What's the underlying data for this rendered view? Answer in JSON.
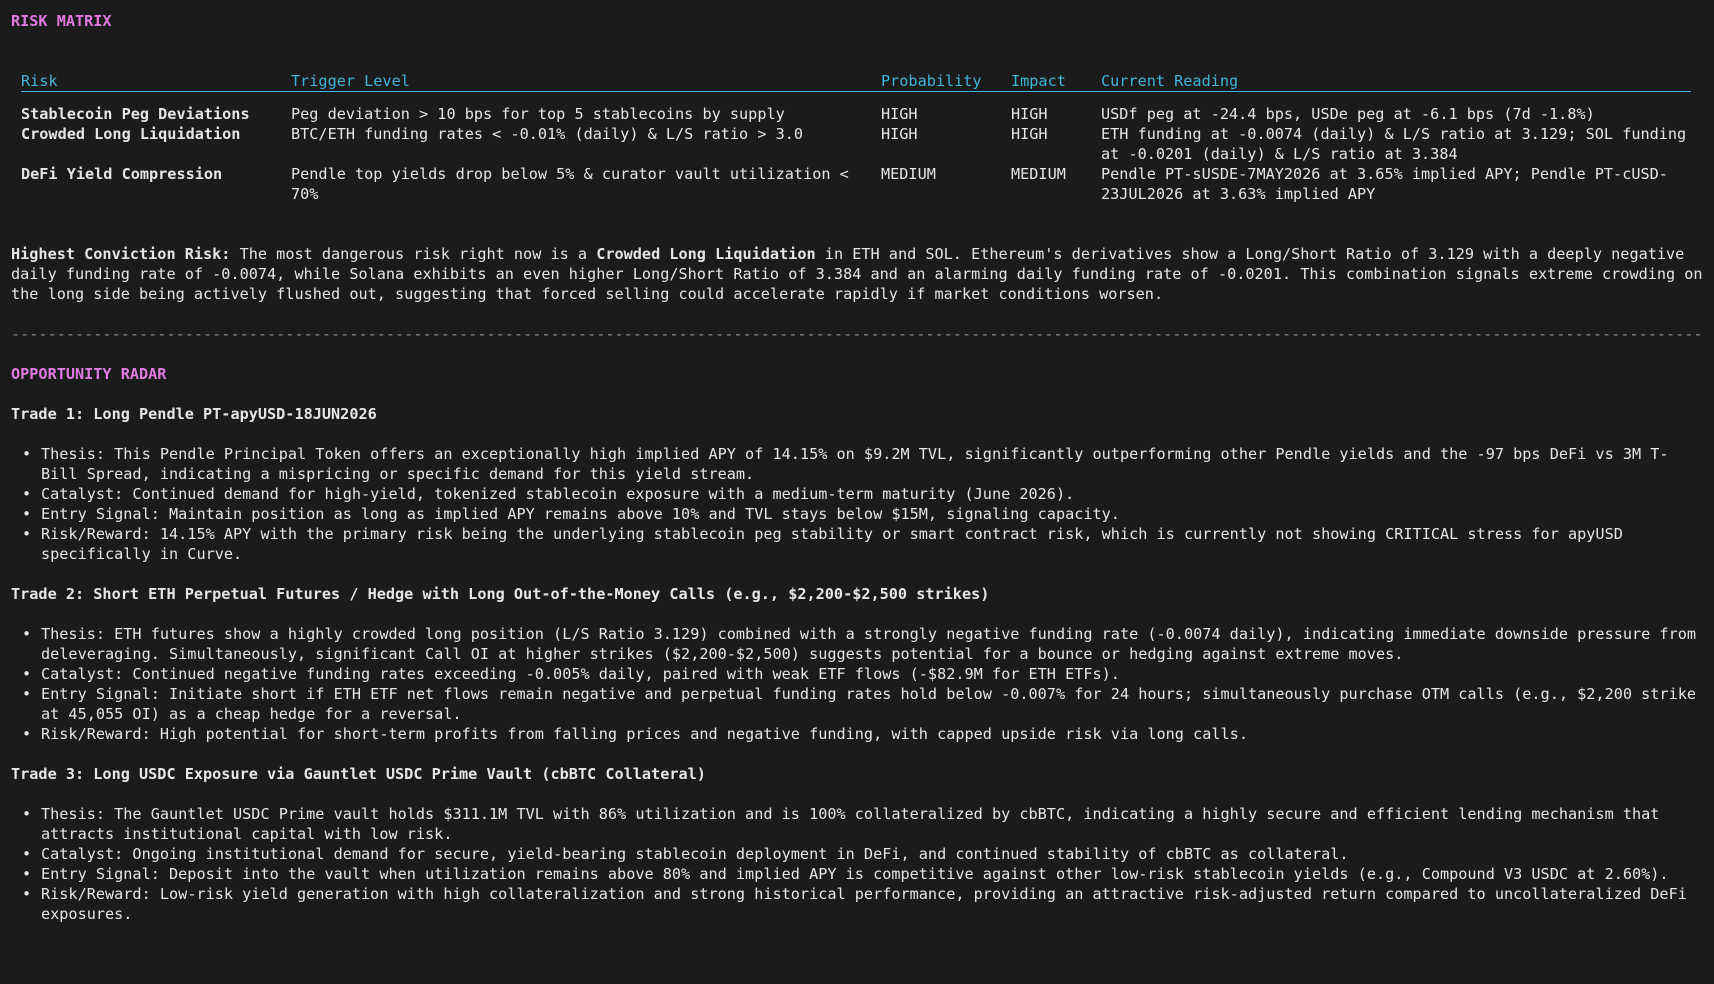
{
  "risk_matrix": {
    "title": "RISK MATRIX",
    "headers": {
      "risk": "Risk",
      "trigger": "Trigger Level",
      "probability": "Probability",
      "impact": "Impact",
      "current": "Current Reading"
    },
    "rows": [
      {
        "risk": "Stablecoin Peg Deviations",
        "trigger": "Peg deviation > 10 bps for top 5 stablecoins by supply",
        "probability": "HIGH",
        "impact": "HIGH",
        "current": "USDf peg at -24.4 bps, USDe peg at -6.1 bps (7d -1.8%)"
      },
      {
        "risk": "Crowded Long Liquidation",
        "trigger": "BTC/ETH funding rates < -0.01% (daily) & L/S ratio > 3.0",
        "probability": "HIGH",
        "impact": "HIGH",
        "current": "ETH funding at -0.0074 (daily) & L/S ratio at 3.129; SOL funding at -0.0201 (daily) & L/S ratio at 3.384"
      },
      {
        "risk": "DeFi Yield Compression",
        "trigger": "Pendle top yields drop below 5% & curator vault utilization < 70%",
        "probability": "MEDIUM",
        "impact": "MEDIUM",
        "current": "Pendle PT-sUSDE-7MAY2026 at 3.65% implied APY; Pendle PT-cUSD-23JUL2026 at 3.63% implied APY"
      }
    ]
  },
  "conviction": {
    "label": "Highest Conviction Risk:",
    "text_1": " The most dangerous risk right now is a ",
    "highlight": "Crowded Long Liquidation",
    "text_2": " in ETH and SOL. Ethereum's derivatives show a Long/Short Ratio of 3.129 with a deeply negative daily funding rate of -0.0074, while Solana exhibits an even higher Long/Short Ratio of 3.384 and an alarming daily funding rate of -0.0201. This combination signals extreme crowding on the long side being actively flushed out, suggesting that forced selling could accelerate rapidly if market conditions worsen."
  },
  "divider": "----------------------------------------------------------------------------------------------------------------------------------------------------------------------------------------------------------------",
  "opportunity_radar": {
    "title": "OPPORTUNITY RADAR",
    "trades": [
      {
        "title": "Trade 1: Long Pendle PT-apyUSD-18JUN2026",
        "bullets": [
          "Thesis: This Pendle Principal Token offers an exceptionally high implied APY of 14.15% on $9.2M TVL, significantly outperforming other Pendle yields and the -97 bps DeFi vs 3M T-Bill Spread, indicating a mispricing or specific demand for this yield stream.",
          "Catalyst: Continued demand for high-yield, tokenized stablecoin exposure with a medium-term maturity (June 2026).",
          "Entry Signal: Maintain position as long as implied APY remains above 10% and TVL stays below $15M, signaling capacity.",
          "Risk/Reward: 14.15% APY with the primary risk being the underlying stablecoin peg stability or smart contract risk, which is currently not showing CRITICAL stress for apyUSD specifically in Curve."
        ]
      },
      {
        "title": "Trade 2: Short ETH Perpetual Futures / Hedge with Long Out-of-the-Money Calls (e.g., $2,200-$2,500 strikes)",
        "bullets": [
          "Thesis: ETH futures show a highly crowded long position (L/S Ratio 3.129) combined with a strongly negative funding rate (-0.0074 daily), indicating immediate downside pressure from deleveraging. Simultaneously, significant Call OI at higher strikes ($2,200-$2,500) suggests potential for a bounce or hedging against extreme moves.",
          "Catalyst: Continued negative funding rates exceeding -0.005% daily, paired with weak ETF flows (-$82.9M for ETH ETFs).",
          "Entry Signal: Initiate short if ETH ETF net flows remain negative and perpetual funding rates hold below -0.007% for 24 hours; simultaneously purchase OTM calls (e.g., $2,200 strike at 45,055 OI) as a cheap hedge for a reversal.",
          "Risk/Reward: High potential for short-term profits from falling prices and negative funding, with capped upside risk via long calls."
        ]
      },
      {
        "title": "Trade 3: Long USDC Exposure via Gauntlet USDC Prime Vault (cbBTC Collateral)",
        "bullets": [
          "Thesis: The Gauntlet USDC Prime vault holds $311.1M TVL with 86% utilization and is 100% collateralized by cbBTC, indicating a highly secure and efficient lending mechanism that attracts institutional capital with low risk.",
          "Catalyst: Ongoing institutional demand for secure, yield-bearing stablecoin deployment in DeFi, and continued stability of cbBTC as collateral.",
          "Entry Signal: Deposit into the vault when utilization remains above 80% and implied APY is competitive against other low-risk stablecoin yields (e.g., Compound V3 USDC at 2.60%).",
          "Risk/Reward: Low-risk yield generation with high collateralization and strong historical performance, providing an attractive risk-adjusted return compared to uncollateralized DeFi exposures."
        ]
      }
    ]
  },
  "bullet_glyph": "•",
  "colors": {
    "background": "#1b1b1b",
    "text": "#e6e6e6",
    "section_title": "#e07ae0",
    "table_header": "#3fb6d8"
  }
}
